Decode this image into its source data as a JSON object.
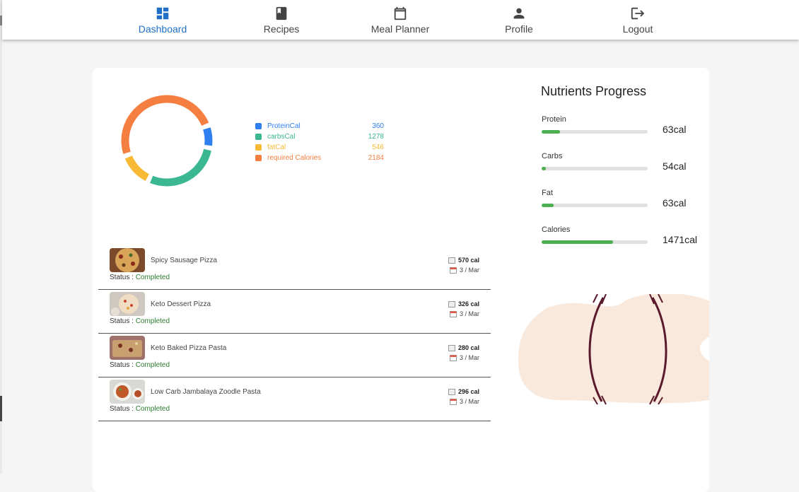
{
  "nav": {
    "items": [
      {
        "label": "Dashboard",
        "icon": "dashboard-icon",
        "active": true
      },
      {
        "label": "Recipes",
        "icon": "book-icon",
        "active": false
      },
      {
        "label": "Meal Planner",
        "icon": "calendar-icon",
        "active": false
      },
      {
        "label": "Profile",
        "icon": "person-icon",
        "active": false
      },
      {
        "label": "Logout",
        "icon": "logout-icon",
        "active": false
      }
    ],
    "active_color": "#1f6fc6"
  },
  "chart_data": {
    "type": "pie",
    "variant": "donut",
    "categories": [
      "ProteinCal",
      "carbsCal",
      "fatCal",
      "required Calories"
    ],
    "values": [
      360,
      1278,
      546,
      2184
    ],
    "colors": [
      "#2f7ff0",
      "#3bb892",
      "#f8b935",
      "#f57f41"
    ],
    "legend_position": "right"
  },
  "nutrients": {
    "title": "Nutrients Progress",
    "items": [
      {
        "label": "Protein",
        "value": "63cal",
        "progress": 0.17
      },
      {
        "label": "Carbs",
        "value": "54cal",
        "progress": 0.04
      },
      {
        "label": "Fat",
        "value": "63cal",
        "progress": 0.11
      },
      {
        "label": "Calories",
        "value": "1471cal",
        "progress": 0.67
      }
    ],
    "bar_color": "#4caf50"
  },
  "recipes": {
    "status_prefix": "Status : ",
    "items": [
      {
        "name": "Spicy Sausage Pizza",
        "status": "Completed",
        "calories": "570 cal",
        "date": "3 / Mar",
        "thumb_icon": "pizza-thumbnail"
      },
      {
        "name": "Keto Dessert Pizza",
        "status": "Completed",
        "calories": "326 cal",
        "date": "3 / Mar",
        "thumb_icon": "dessert-pizza-thumbnail"
      },
      {
        "name": "Keto Baked Pizza Pasta",
        "status": "Completed",
        "calories": "280 cal",
        "date": "3 / Mar",
        "thumb_icon": "baked-pasta-thumbnail"
      },
      {
        "name": "Low Carb Jambalaya Zoodle Pasta",
        "status": "Completed",
        "calories": "296 cal",
        "date": "3 / Mar",
        "thumb_icon": "jambalaya-thumbnail"
      }
    ],
    "status_color": "#2e7d32"
  }
}
